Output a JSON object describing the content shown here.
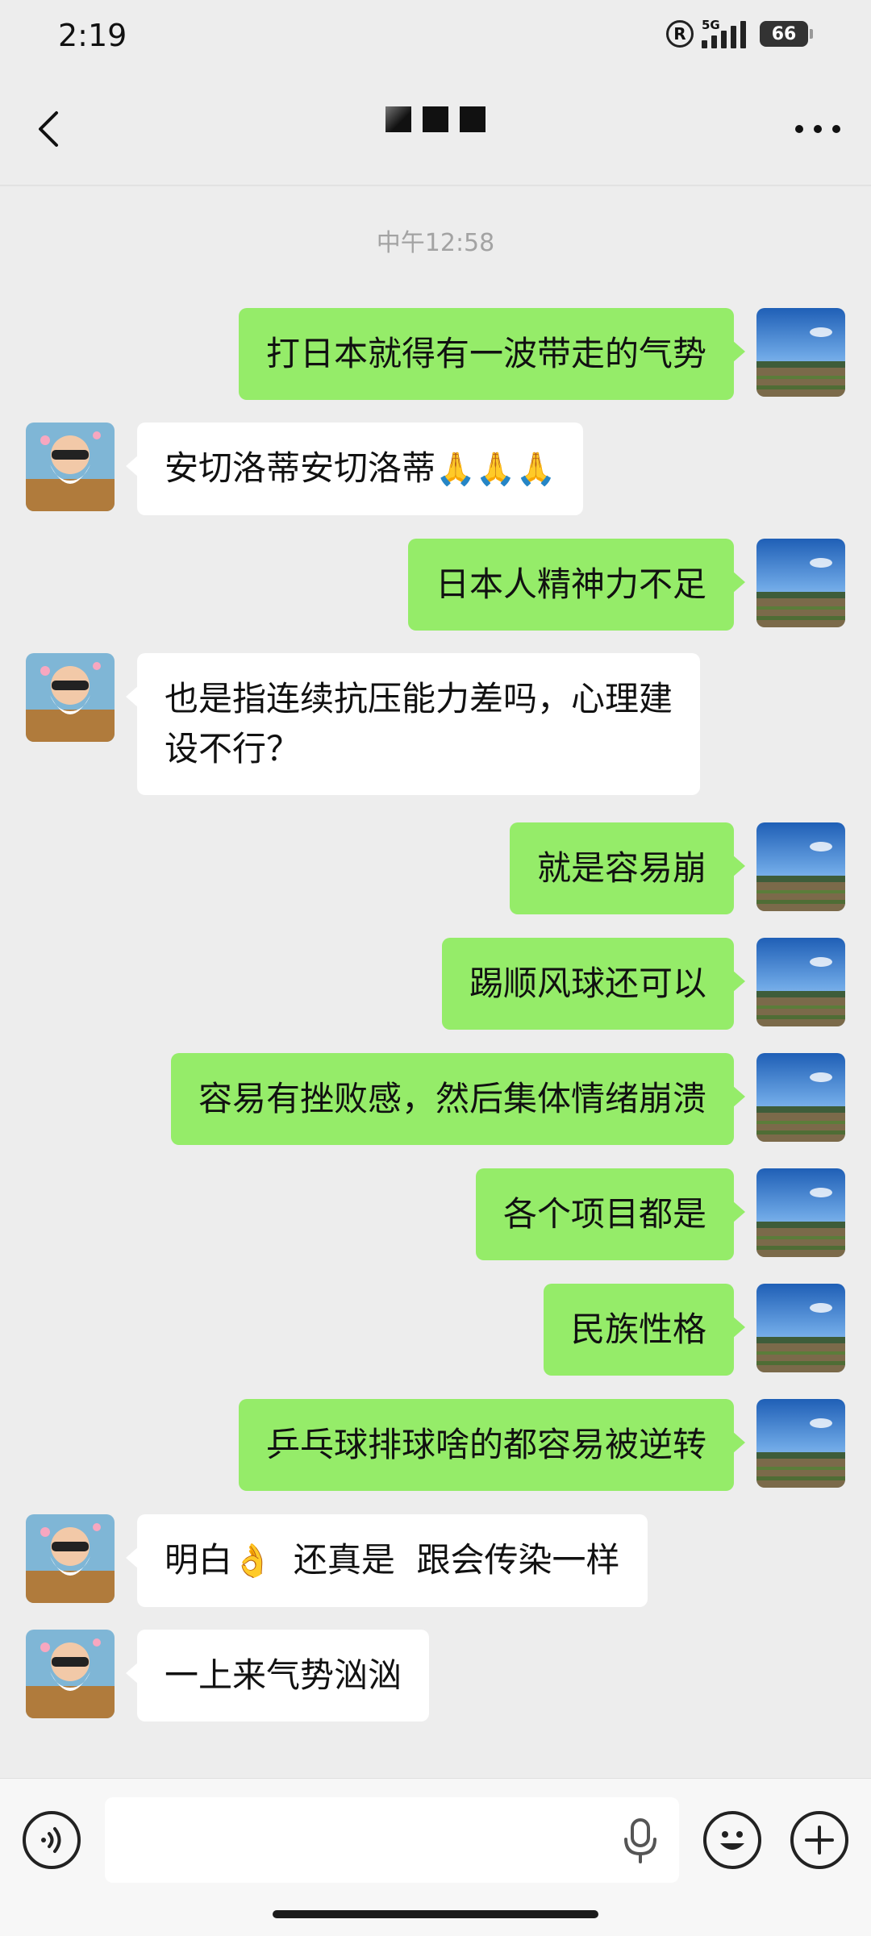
{
  "status_bar": {
    "time": "2:19",
    "network": "5G",
    "battery": "66"
  },
  "header": {
    "title_masked": true
  },
  "chat": {
    "timestamp": "中午12:58",
    "messages": [
      {
        "side": "me",
        "text": "打日本就得有一波带走的气势"
      },
      {
        "side": "them",
        "text": "安切洛蒂安切洛蒂",
        "emoji": "🙏🙏🙏"
      },
      {
        "side": "me",
        "text": "日本人精神力不足"
      },
      {
        "side": "them",
        "line1": "也是指连续抗压能力差吗，心理建",
        "line2": "设不行？"
      },
      {
        "side": "me",
        "text": "就是容易崩"
      },
      {
        "side": "me",
        "text": "踢顺风球还可以"
      },
      {
        "side": "me",
        "text": "容易有挫败感，然后集体情绪崩溃"
      },
      {
        "side": "me",
        "text": "各个项目都是"
      },
      {
        "side": "me",
        "text": "民族性格"
      },
      {
        "side": "me",
        "text": "乒乓球排球啥的都容易被逆转"
      },
      {
        "side": "them",
        "text_a": "明白",
        "emoji": "👌",
        "text_b": "还真是  跟会传染一样"
      },
      {
        "side": "them",
        "text": "一上来气势汹汹"
      }
    ]
  },
  "input_bar": {
    "value": "",
    "icons": [
      "voice-icon",
      "microphone-icon",
      "emoji-icon",
      "add-icon"
    ]
  },
  "colors": {
    "my_bubble": "#95ec69",
    "their_bubble": "#ffffff",
    "background": "#ededed"
  }
}
